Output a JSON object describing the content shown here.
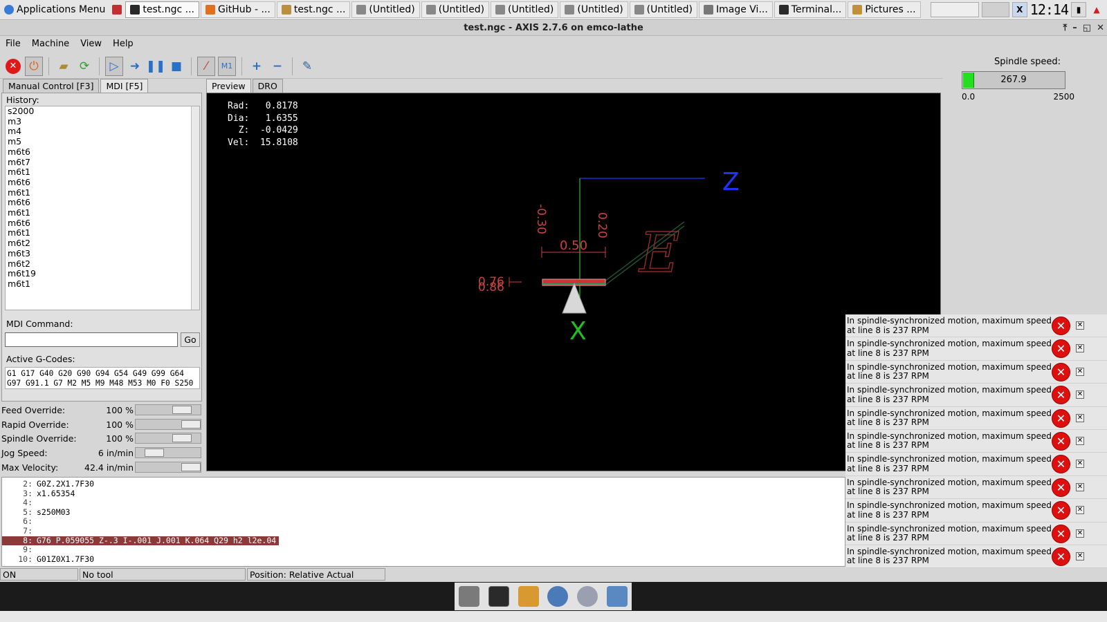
{
  "taskbar": {
    "app_menu": "Applications Menu",
    "tasks": [
      {
        "label": "test.ngc ...",
        "active": true
      },
      {
        "label": "GitHub - ..."
      },
      {
        "label": "test.ngc ..."
      },
      {
        "label": "(Untitled)"
      },
      {
        "label": "(Untitled)"
      },
      {
        "label": "(Untitled)"
      },
      {
        "label": "(Untitled)"
      },
      {
        "label": "(Untitled)"
      },
      {
        "label": "Image Vi..."
      },
      {
        "label": "Terminal..."
      },
      {
        "label": "Pictures ..."
      }
    ],
    "clock": "12:14"
  },
  "window": {
    "title": "test.ngc - AXIS 2.7.6 on emco-lathe"
  },
  "menu": [
    "File",
    "Machine",
    "View",
    "Help"
  ],
  "spindle": {
    "label": "Spindle speed:",
    "value": "267.9",
    "min": "0.0",
    "max": "2500",
    "level": 0.107
  },
  "left_tabs": [
    "Manual Control [F3]",
    "MDI [F5]"
  ],
  "mdi": {
    "history_label": "History:",
    "history": [
      "s2000",
      "m3",
      "m4",
      "m5",
      "m6t6",
      "m6t7",
      "m6t1",
      "m6t6",
      "m6t1",
      "m6t6",
      "m6t1",
      "m6t6",
      "m6t1",
      "m6t2",
      "m6t3",
      "m6t2",
      "m6t19",
      "m6t1"
    ],
    "command_label": "MDI Command:",
    "go": "Go",
    "gcodes_label": "Active G-Codes:",
    "gcodes_line1": "G1 G17 G40 G20 G90 G94 G54 G49 G99 G64",
    "gcodes_line2": "G97 G91.1 G7 M2 M5 M9 M48 M53 M0 F0 S250"
  },
  "overrides": [
    {
      "label": "Feed Override:",
      "value": "100 %",
      "level": 0.8
    },
    {
      "label": "Rapid Override:",
      "value": "100 %",
      "level": 1.0
    },
    {
      "label": "Spindle Override:",
      "value": "100 %",
      "level": 0.8
    },
    {
      "label": "Jog Speed:",
      "value": "6 in/min",
      "level": 0.2
    },
    {
      "label": "Max Velocity:",
      "value": "42.4 in/min",
      "level": 1.0
    }
  ],
  "preview_tabs": [
    "Preview",
    "DRO"
  ],
  "dro": {
    "rad_label": "Rad:",
    "rad": "0.8178",
    "dia_label": "Dia:",
    "dia": "1.6355",
    "z_label": "Z:",
    "z": "-0.0429",
    "vel_label": "Vel:",
    "vel": "15.8108"
  },
  "preview": {
    "axis_z": "Z",
    "axis_x": "X",
    "dim_a": "-0.30",
    "dim_b": "0.20",
    "dim_c": "0.50",
    "dim_d": "0.76",
    "dim_e": "0.86",
    "origin_letter": "E"
  },
  "code": [
    {
      "n": "2:",
      "t": "G0Z.2X1.7F30"
    },
    {
      "n": "3:",
      "t": "x1.65354"
    },
    {
      "n": "4:",
      "t": ""
    },
    {
      "n": "5:",
      "t": "s250M03"
    },
    {
      "n": "6:",
      "t": ""
    },
    {
      "n": "7:",
      "t": ""
    },
    {
      "n": "8:",
      "t": "G76 P.059055 Z-.3 I-.001 J.001 K.064 Q29 h2 l2e.04",
      "hl": true
    },
    {
      "n": "9:",
      "t": ""
    },
    {
      "n": "10:",
      "t": "G01Z0X1.7F30"
    }
  ],
  "status": {
    "state": "ON",
    "tool": "No tool",
    "position": "Position: Relative Actual"
  },
  "notifications": {
    "text": "In spindle-synchronized motion, maximum speed at line 8 is 237 RPM",
    "count": 11
  },
  "colors": {
    "spindle_fill": "#22e020",
    "highlight": "#8b3a3a",
    "error": "#dd1010"
  }
}
